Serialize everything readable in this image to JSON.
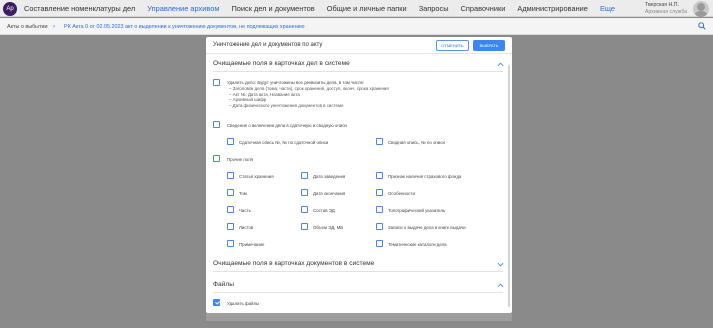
{
  "header": {
    "logo_text": "Ар",
    "nav": [
      {
        "label": "Составление номенклатуры дел",
        "active": false
      },
      {
        "label": "Управление архивом",
        "active": true
      },
      {
        "label": "Поиск дел и документов",
        "active": false
      },
      {
        "label": "Общие и личные папки",
        "active": false
      },
      {
        "label": "Запросы",
        "active": false
      },
      {
        "label": "Справочники",
        "active": false
      },
      {
        "label": "Администрирование",
        "active": false
      },
      {
        "label": "Еще",
        "active": false
      }
    ],
    "user_name": "Тверская Н.П.",
    "user_role": "Архивная служба"
  },
  "breadcrumb": {
    "items": [
      "Акты о выбытии",
      "РК Акта 0 от 02.05.2023 акт о выделении к уничтожению документов, не подлежащих хранению"
    ]
  },
  "modal": {
    "title": "Уничтожение дел и документов по акту",
    "cancel_label": "ОТМЕНИТЬ",
    "select_label": "ВЫБРАТЬ",
    "section1": {
      "title": "Очищаемые поля в карточках дел в системе",
      "delete_label": "Удалить дело: Будут уничтожены все реквизиты дела, в том числе:",
      "delete_items": [
        "– Заголовок дела (тома, части), срок хранения, доступ, оконч. срока хранения",
        "– Акт №, Дата акта, Название акта",
        "– Архивный шифр",
        "– Дата физического уничтожения документов в системе"
      ],
      "inventory_label": "Сведения о включении дела в сдаточную и сводную описи",
      "inventory_children": [
        "Сдаточная опись №, № по сдаточной описи",
        "Сводная опись, № по описи"
      ],
      "other_label": "Прочие поля",
      "other_fields": [
        [
          "Статья хранения",
          "Дата заведения",
          "Признак наличия страхового фонда"
        ],
        [
          "Том",
          "Дата окончания",
          "Особенности"
        ],
        [
          "Часть",
          "Состав ЭД",
          "Топографический указатель"
        ],
        [
          "Листов",
          "Объем ЭД, МБ",
          "Записи о выдаче дела в книге выдачи"
        ],
        [
          "Примечание",
          "",
          "Тематические каталоги дела"
        ]
      ]
    },
    "section2": {
      "title": "Очищаемые поля в карточках документов в системе"
    },
    "section3": {
      "title": "Файлы",
      "delete_files_label": "Удалить файлы",
      "delete_files_checked": true
    }
  },
  "colors": {
    "accent": "#3d86ef",
    "nav_active": "#2b6cd6",
    "overlay": "#8a8a8a"
  }
}
